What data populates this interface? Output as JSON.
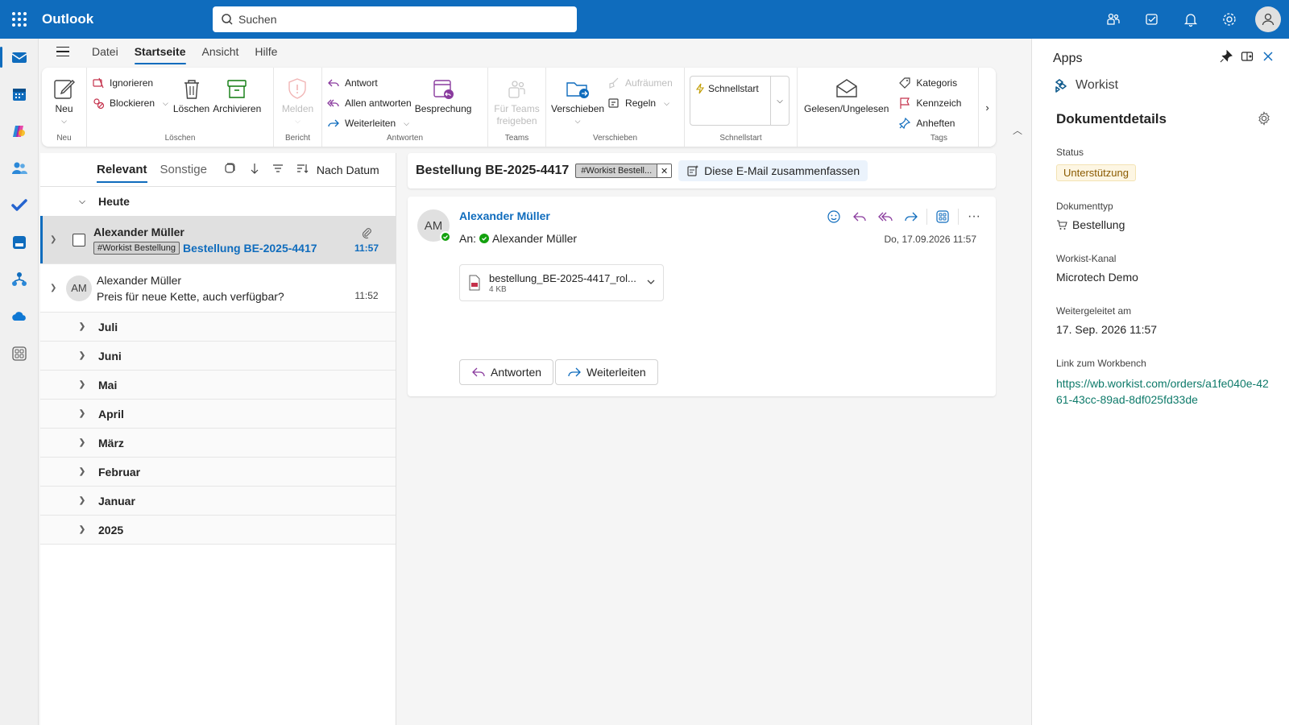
{
  "app": {
    "name": "Outlook"
  },
  "search": {
    "placeholder": "Suchen"
  },
  "menu": {
    "tabs": [
      "Datei",
      "Startseite",
      "Ansicht",
      "Hilfe"
    ],
    "active": "Startseite"
  },
  "ribbon": {
    "neu": {
      "label": "Neu",
      "group": "Neu"
    },
    "loeschen": {
      "ignore": "Ignorieren",
      "block": "Blockieren",
      "delete": "Löschen",
      "archive": "Archivieren",
      "group": "Löschen"
    },
    "bericht": {
      "report": "Melden",
      "group": "Bericht"
    },
    "antworten": {
      "reply": "Antwort",
      "reply_all": "Allen antworten",
      "forward": "Weiterleiten",
      "meeting": "Besprechung",
      "group": "Antworten"
    },
    "teams": {
      "share_line1": "Für Teams",
      "share_line2": "freigeben",
      "group": "Teams"
    },
    "verschieben": {
      "move": "Verschieben",
      "cleanup": "Aufräumen",
      "rules": "Regeln",
      "group": "Verschieben"
    },
    "schnellstart": {
      "label": "Schnellstart",
      "group": "Schnellstart"
    },
    "tags": {
      "read_unread": "Gelesen/Ungelesen",
      "categorize": "Kategoris",
      "flag": "Kennzeich",
      "pin": "Anheften",
      "group": "Tags"
    }
  },
  "list": {
    "tabs": {
      "focused": "Relevant",
      "other": "Sonstige"
    },
    "sort": "Nach Datum",
    "today": "Heute",
    "items": [
      {
        "from": "Alexander Müller",
        "tag": "#Workist Bestellung",
        "subject": "Bestellung BE-2025-4417",
        "time": "11:57"
      },
      {
        "initials": "AM",
        "from": "Alexander Müller",
        "subject": "Preis für neue Kette, auch verfügbar?",
        "time": "11:52"
      }
    ],
    "groups": [
      "Juli",
      "Juni",
      "Mai",
      "April",
      "März",
      "Februar",
      "Januar",
      "2025"
    ]
  },
  "reading": {
    "subject": "Bestellung BE-2025-4417",
    "tag": "#Workist Bestell...",
    "summarize": "Diese E-Mail zusammenfassen",
    "sender_initials": "AM",
    "sender": "Alexander Müller",
    "to_label": "An:",
    "to": "Alexander Müller",
    "date": "Do, 17.09.2026 11:57",
    "attachment": {
      "name": "bestellung_BE-2025-4417_rol...",
      "size": "4 KB"
    },
    "reply": "Antworten",
    "forward": "Weiterleiten"
  },
  "apps": {
    "title": "Apps",
    "addin": "Workist",
    "doc_title": "Dokumentdetails",
    "status_label": "Status",
    "status_value": "Unterstützung",
    "doctype_label": "Dokumenttyp",
    "doctype_value": "Bestellung",
    "channel_label": "Workist-Kanal",
    "channel_value": "Microtech Demo",
    "forwarded_label": "Weitergeleitet am",
    "forwarded_value": "17. Sep. 2026 11:57",
    "link_label": "Link zum Workbench",
    "link_value": "https://wb.workist.com/orders/a1fe040e-4261-43cc-89ad-8df025fd33de"
  },
  "colors": {
    "brand": "#0f6cbd",
    "presence": "#13a10e",
    "link": "#0e7a6a"
  }
}
